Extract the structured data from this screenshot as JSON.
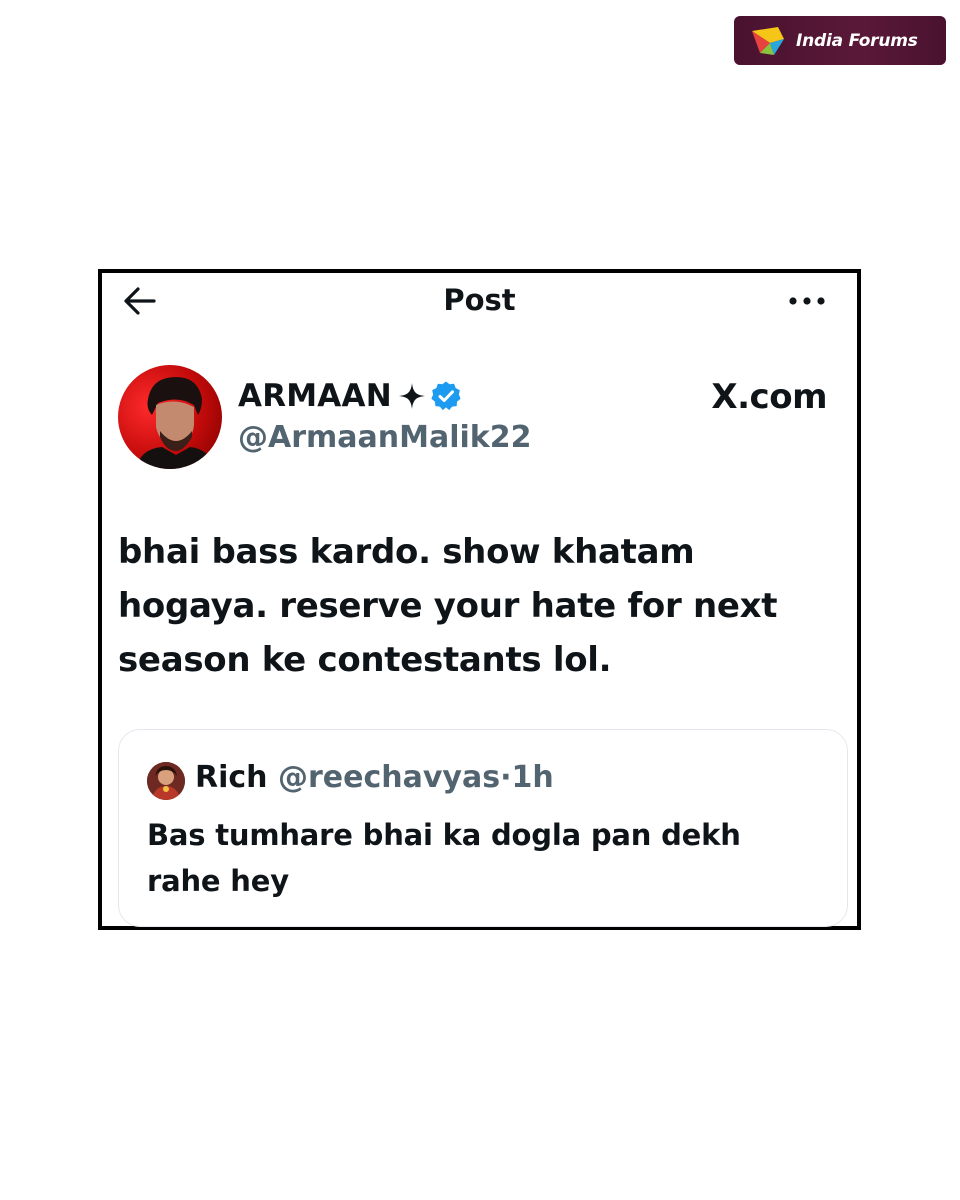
{
  "watermark": {
    "name": "India Forums"
  },
  "top_bar": {
    "title": "Post"
  },
  "post": {
    "author": {
      "display_name": "ARMAAN",
      "handle": "@ArmaanMalik22",
      "verified": true
    },
    "source": "X.com",
    "text": "bhai bass kardo. show khatam hogaya. reserve your hate for next season ke contestants lol."
  },
  "quoted_post": {
    "author_name": "Rich",
    "handle": "@reechavyas",
    "separator": "·",
    "time": "1h",
    "text": "Bas tumhare bhai ka dogla pan dekh rahe hey"
  },
  "colors": {
    "text_primary": "#0f1419",
    "text_secondary": "#536471",
    "verified_blue": "#1d9bf0",
    "badge_background": "#4f1433",
    "avatar_red": "#d41414"
  },
  "icons": {
    "back": "back-arrow-icon",
    "more": "more-dots-icon",
    "sparkle": "sparkle-icon",
    "verified": "verified-badge-icon"
  }
}
